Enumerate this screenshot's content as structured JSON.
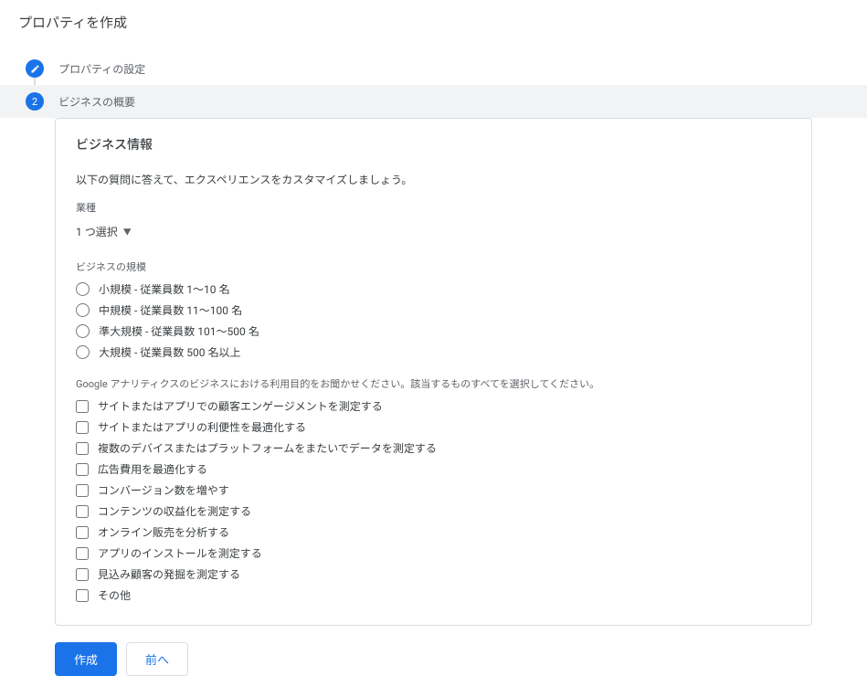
{
  "page": {
    "title": "プロパティを作成"
  },
  "stepper": {
    "step1": {
      "label": "プロパティの設定"
    },
    "step2": {
      "number": "2",
      "label": "ビジネスの概要"
    }
  },
  "card": {
    "title": "ビジネス情報",
    "intro": "以下の質問に答えて、エクスペリエンスをカスタマイズしましょう。",
    "industry": {
      "label": "業種",
      "selected": "1 つ選択"
    },
    "size": {
      "label": "ビジネスの規模",
      "options": [
        "小規模 - 従業員数 1～10 名",
        "中規模 - 従業員数 11～100 名",
        "準大規模 - 従業員数 101～500 名",
        "大規模 - 従業員数 500 名以上"
      ]
    },
    "purpose": {
      "label": "Google アナリティクスのビジネスにおける利用目的をお聞かせください。該当するものすべてを選択してください。",
      "options": [
        "サイトまたはアプリでの顧客エンゲージメントを測定する",
        "サイトまたはアプリの利便性を最適化する",
        "複数のデバイスまたはプラットフォームをまたいでデータを測定する",
        "広告費用を最適化する",
        "コンバージョン数を増やす",
        "コンテンツの収益化を測定する",
        "オンライン販売を分析する",
        "アプリのインストールを測定する",
        "見込み顧客の発掘を測定する",
        "その他"
      ]
    }
  },
  "actions": {
    "create": "作成",
    "back": "前へ"
  }
}
